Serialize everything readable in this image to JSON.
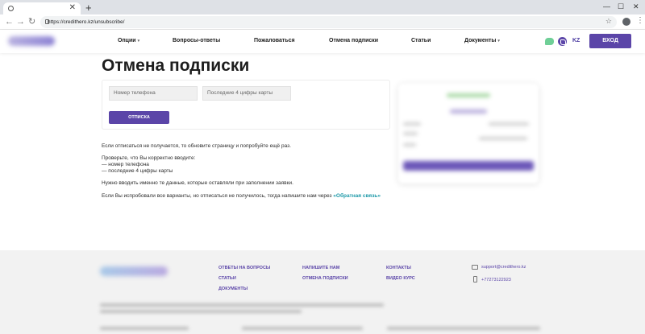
{
  "browser": {
    "url": "https://credithero.kz/unsubscribe/",
    "icons": [
      "favicon-icon",
      "close-icon",
      "plus-icon",
      "minimize-icon",
      "maximize-icon",
      "back-icon",
      "forward-icon",
      "reload-icon",
      "lock-icon",
      "star-icon",
      "profile-icon",
      "kebab-icon"
    ]
  },
  "header": {
    "nav": [
      {
        "label": "Опции",
        "dropdown": true
      },
      {
        "label": "Вопросы-ответы",
        "dropdown": false
      },
      {
        "label": "Пожаловаться",
        "dropdown": false
      },
      {
        "label": "Отмена подписки",
        "dropdown": false
      },
      {
        "label": "Статьи",
        "dropdown": false
      },
      {
        "label": "Документы",
        "dropdown": true
      }
    ],
    "lang": "KZ",
    "login": "ВХОД"
  },
  "main": {
    "title": "Отмена подписки",
    "phone_placeholder": "Номер телефона",
    "card_placeholder": "Последние 4 цифры карты",
    "button": "ОТПИСКА",
    "text1": "Если отписаться не получается, то обновите страницу и попробуйте ещё раз.",
    "text2": "Проверьте, что Вы корректно вводите:",
    "text3": "— номер телефона",
    "text4": "— последние 4 цифры карты",
    "text5": "Нужно вводить именно те данные, которые оставляли при заполнении заявки.",
    "text6_prefix": "Если Вы испробовали все варианты, но отписаться не получилось, тогда напишите нам через",
    "text6_link": "«Обратная связь»"
  },
  "footer": {
    "col1": [
      "ОТВЕТЫ НА ВОПРОСЫ",
      "СТАТЬИ",
      "ДОКУМЕНТЫ"
    ],
    "col2": [
      "НАПИШИТЕ НАМ",
      "ОТМЕНА ПОДПИСКИ"
    ],
    "col3": [
      "КОНТАКТЫ",
      "ВИДЕО КУРС"
    ],
    "email": "support@credithero.kz",
    "phone": "+77273122923"
  },
  "colors": {
    "brand_purple": "#5b45a8",
    "link_teal": "#1f9aa9",
    "chat_green": "#6fcf97",
    "footer_bg": "#f2f2f2"
  }
}
